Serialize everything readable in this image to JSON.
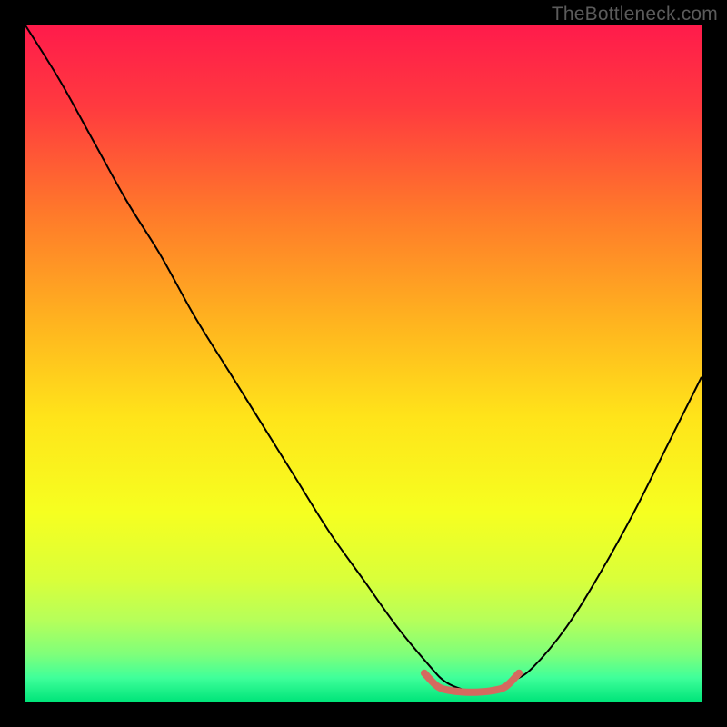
{
  "watermark": "TheBottleneck.com",
  "chart_data": {
    "type": "line",
    "title": "",
    "xlabel": "",
    "ylabel": "",
    "xlim": [
      0,
      100
    ],
    "ylim": [
      0,
      100
    ],
    "grid": false,
    "legend": false,
    "background": {
      "type": "vertical-gradient",
      "stops": [
        {
          "pos": 0.0,
          "color": "#ff1b4b"
        },
        {
          "pos": 0.12,
          "color": "#ff3a3f"
        },
        {
          "pos": 0.28,
          "color": "#ff7a2a"
        },
        {
          "pos": 0.44,
          "color": "#ffb41f"
        },
        {
          "pos": 0.58,
          "color": "#ffe41a"
        },
        {
          "pos": 0.72,
          "color": "#f6ff20"
        },
        {
          "pos": 0.82,
          "color": "#d9ff3a"
        },
        {
          "pos": 0.88,
          "color": "#b6ff5a"
        },
        {
          "pos": 0.93,
          "color": "#7fff7a"
        },
        {
          "pos": 0.965,
          "color": "#3fff9a"
        },
        {
          "pos": 1.0,
          "color": "#00e57a"
        }
      ]
    },
    "series": [
      {
        "name": "curve",
        "stroke": "#000000",
        "stroke_width": 2,
        "x": [
          0,
          5,
          10,
          15,
          20,
          25,
          30,
          35,
          40,
          45,
          50,
          55,
          60,
          62,
          64,
          66,
          68,
          70,
          72,
          75,
          80,
          85,
          90,
          95,
          100
        ],
        "y": [
          100,
          92,
          83,
          74,
          66,
          57,
          49,
          41,
          33,
          25,
          18,
          11,
          5,
          3,
          2,
          1.5,
          1.5,
          2,
          3,
          5,
          11,
          19,
          28,
          38,
          48
        ]
      },
      {
        "name": "bottom-marker",
        "stroke": "#d46a5f",
        "stroke_width": 8,
        "linecap": "round",
        "x": [
          59,
          61,
          63,
          65,
          67,
          69,
          71,
          73
        ],
        "y": [
          4.2,
          2.2,
          1.6,
          1.4,
          1.4,
          1.6,
          2.2,
          4.2
        ]
      }
    ]
  }
}
